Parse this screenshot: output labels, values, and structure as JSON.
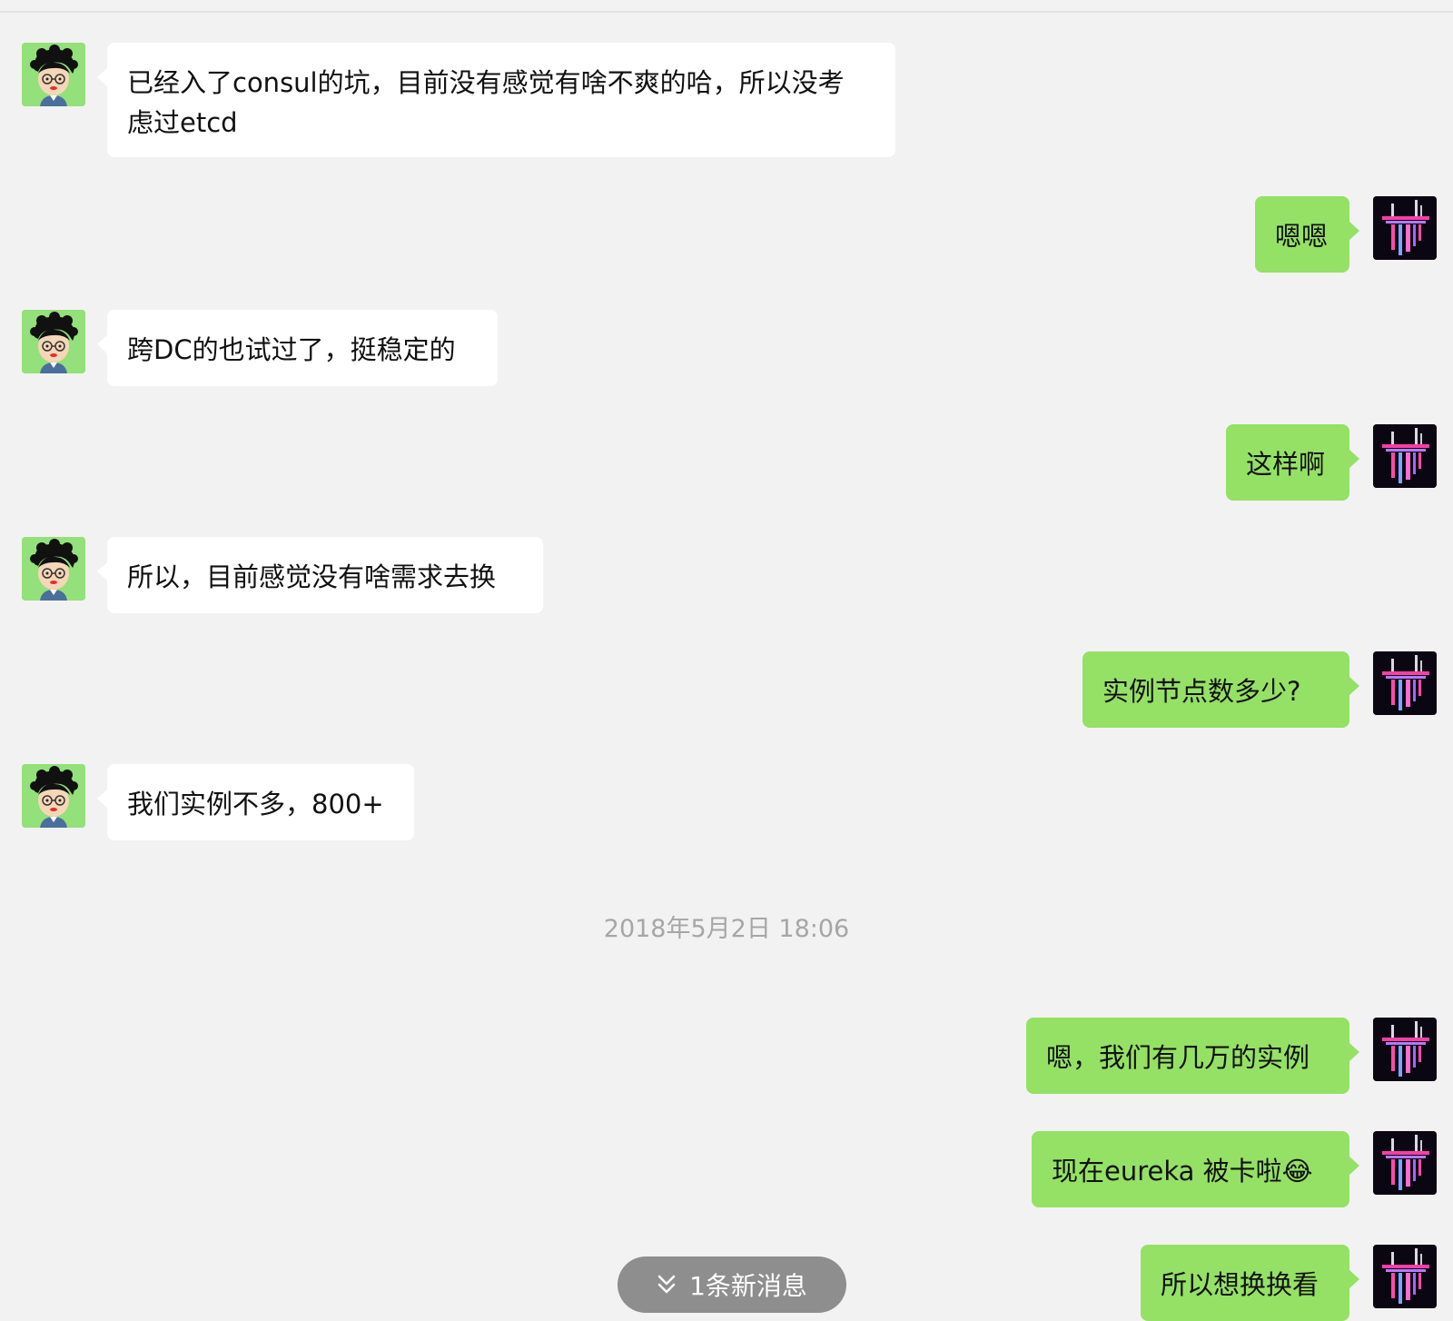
{
  "chat": {
    "messages": [
      {
        "side": "left",
        "text": "已经入了consul的坑，目前没有感觉有啥不爽的哈，所以没考\n虑过etcd"
      },
      {
        "side": "right",
        "text": "嗯嗯"
      },
      {
        "side": "left",
        "text": "跨DC的也试过了，挺稳定的"
      },
      {
        "side": "right",
        "text": "这样啊"
      },
      {
        "side": "left",
        "text": "所以，目前感觉没有啥需求去换"
      },
      {
        "side": "right",
        "text": "实例节点数多少?"
      },
      {
        "side": "left",
        "text": "我们实例不多，800+"
      },
      {
        "side": "right",
        "text": "嗯，我们有几万的实例"
      },
      {
        "side": "right",
        "text": "现在eureka 被卡啦😂"
      },
      {
        "side": "right",
        "text": "所以想换换看"
      }
    ],
    "timestamp": "2018年5月2日 18:06",
    "new_message_indicator": "1条新消息"
  },
  "icons": {
    "left_avatar": "cartoon-boy-avatar-icon",
    "right_avatar": "night-city-avatar-icon",
    "new_message": "double-chevron-down-icon"
  },
  "colors": {
    "background": "#f2f2f2",
    "incoming_bubble": "#ffffff",
    "outgoing_bubble": "#95e165",
    "timestamp": "#a6a6a6",
    "pill": "#8e8e8e"
  }
}
